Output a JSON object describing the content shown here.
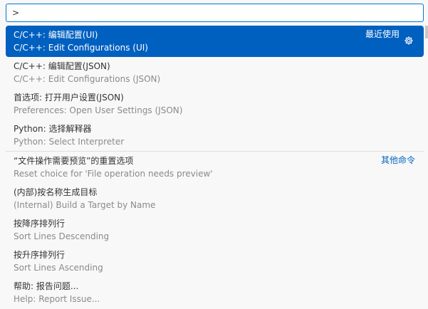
{
  "quick_input": {
    "value": ">",
    "placeholder": ""
  },
  "items": [
    {
      "label": "C/C++: 编辑配置(UI)",
      "detail": "C/C++: Edit Configurations (UI)",
      "group": "最近使用",
      "selected": true
    },
    {
      "label": "C/C++: 编辑配置(JSON)",
      "detail": "C/C++: Edit Configurations (JSON)",
      "group": ""
    },
    {
      "label": "首选项: 打开用户设置(JSON)",
      "detail": "Preferences: Open User Settings (JSON)",
      "group": ""
    },
    {
      "label": "Python: 选择解释器",
      "detail": "Python: Select Interpreter",
      "group": ""
    },
    {
      "label": "“文件操作需要预览”的重置选项",
      "detail": "Reset choice for 'File operation needs preview'",
      "group": "其他命令"
    },
    {
      "label": "(内部)按名称生成目标",
      "detail": "(Internal) Build a Target by Name",
      "group": ""
    },
    {
      "label": "按降序排列行",
      "detail": "Sort Lines Descending",
      "group": ""
    },
    {
      "label": "按升序排列行",
      "detail": "Sort Lines Ascending",
      "group": ""
    },
    {
      "label": "帮助: 报告问题...",
      "detail": "Help: Report Issue...",
      "group": ""
    }
  ],
  "icons": {
    "configure": "gear-icon"
  },
  "colors": {
    "selection": "#0060c0",
    "focus_border": "#0078d4",
    "group_label": "#0066bf"
  }
}
